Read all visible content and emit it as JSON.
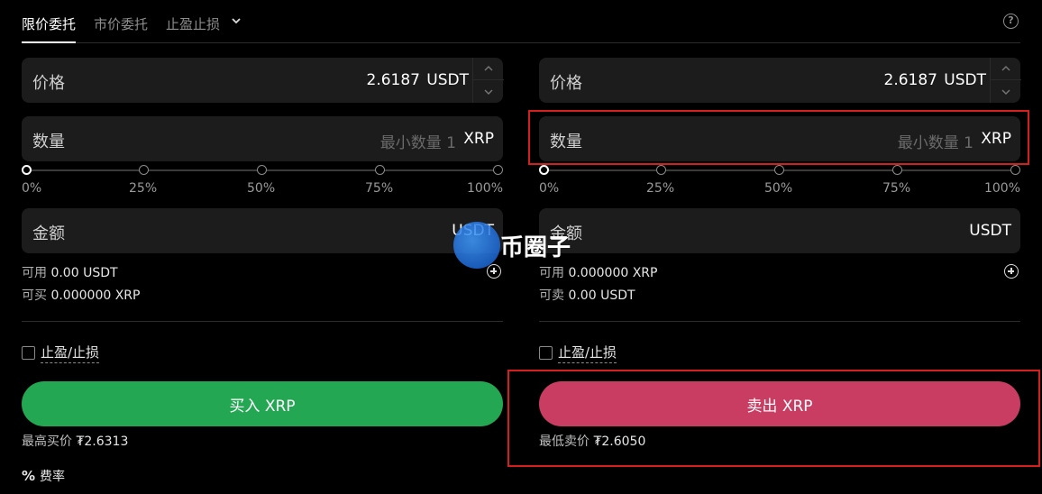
{
  "tabs": {
    "limit": "限价委托",
    "market": "市价委托",
    "tpsl": "止盈止损"
  },
  "help_icon": "?",
  "buy": {
    "price_label": "价格",
    "price_value": "2.6187",
    "price_unit": "USDT",
    "qty_label": "数量",
    "qty_placeholder": "最小数量 1",
    "qty_unit": "XRP",
    "pcts": [
      "0%",
      "25%",
      "50%",
      "75%",
      "100%"
    ],
    "amount_label": "金额",
    "amount_unit": "USDT",
    "avail_label": "可用",
    "avail_value": "0.00 USDT",
    "can_label": "可买",
    "can_value": "0.000000 XRP",
    "tpsl_label": "止盈/止损",
    "button": "买入 XRP",
    "best_label": "最高买价",
    "best_value": "₮2.6313"
  },
  "sell": {
    "price_label": "价格",
    "price_value": "2.6187",
    "price_unit": "USDT",
    "qty_label": "数量",
    "qty_placeholder": "最小数量 1",
    "qty_unit": "XRP",
    "pcts": [
      "0%",
      "25%",
      "50%",
      "75%",
      "100%"
    ],
    "amount_label": "金额",
    "amount_unit": "USDT",
    "avail_label": "可用",
    "avail_value": "0.000000 XRP",
    "can_label": "可卖",
    "can_value": "0.00 USDT",
    "tpsl_label": "止盈/止损",
    "button": "卖出 XRP",
    "best_label": "最低卖价",
    "best_value": "₮2.6050"
  },
  "fee": {
    "symbol": "%",
    "label": "费率"
  },
  "watermark": "币圈子",
  "colors": {
    "buy": "#24a752",
    "sell": "#c93d62",
    "highlight": "#d41f1f"
  }
}
